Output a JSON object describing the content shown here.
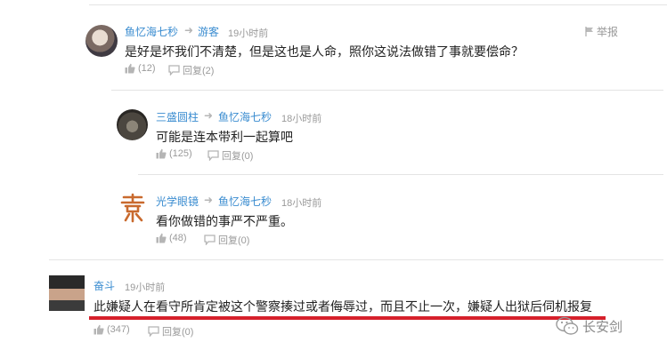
{
  "comments": [
    {
      "user": "鱼忆海七秒",
      "reply_to": "游客",
      "time": "19小时前",
      "text": "是好是坏我们不清楚，但是这也是人命，照你这说法做错了事就要偿命？",
      "likes": "(12)",
      "reply_label": "回复(2)",
      "report_label": "举报"
    },
    {
      "user": "三盛圆柱",
      "reply_to": "鱼忆海七秒",
      "time": "18小时前",
      "text": "可能是连本带利一起算吧",
      "likes": "(125)",
      "reply_label": "回复(0)"
    },
    {
      "user": "光学眼镜",
      "reply_to": "鱼忆海七秒",
      "time": "18小时前",
      "text": "看你做错的事严不严重。",
      "likes": "(48)",
      "reply_label": "回复(0)"
    },
    {
      "user": "奋斗",
      "time": "19小时前",
      "text": "此嫌疑人在看守所肯定被这个警察揍过或者侮辱过，而且不止一次，嫌疑人出狱后伺机报复",
      "likes": "(347)",
      "reply_label": "回复(0)"
    }
  ],
  "watermark": "长安剑",
  "colors": {
    "username": "#3a8cd0",
    "meta": "#999999",
    "highlight": "#d6202b"
  },
  "icons": [
    "thumbs-up-icon",
    "reply-icon",
    "flag-icon",
    "arrow-icon",
    "wechat-icon"
  ]
}
